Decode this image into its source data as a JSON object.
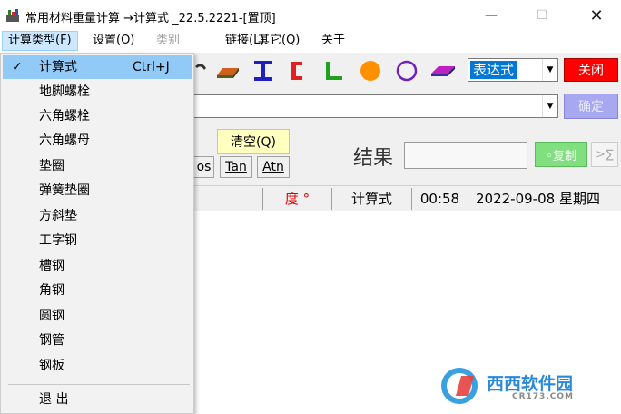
{
  "window": {
    "title": "常用材料重量计算 →计算式 _22.5.2221-[置顶]",
    "minimize_glyph": "—",
    "maximize_glyph": "☐",
    "close_glyph": "✕"
  },
  "menubar": {
    "items": [
      {
        "label": "计算类型(F)",
        "state": "active"
      },
      {
        "label": "设置(O)",
        "state": "normal"
      },
      {
        "label": "类别",
        "state": "disabled"
      },
      {
        "label": "链接(L)",
        "state": "normal"
      },
      {
        "label": "其它(Q)",
        "state": "normal"
      },
      {
        "label": "关于",
        "state": "normal"
      }
    ]
  },
  "toolbar": {
    "icons": [
      "bolt-icon",
      "flat-bar-icon",
      "i-beam-icon",
      "channel-icon",
      "angle-icon",
      "round-bar-icon",
      "pipe-icon",
      "plate-icon"
    ],
    "expression_select": "表达式",
    "close_label": "关闭"
  },
  "input_row": {
    "value": "",
    "confirm_label": "确定"
  },
  "calc_row": {
    "clear_label": "清空(Q)",
    "fn_cos": "os",
    "fn_tan": "Tan",
    "fn_atn": "Atn",
    "result_label": "结果",
    "result_value": "",
    "copy_label": "◦复制",
    "sigma_label": ">∑"
  },
  "statusbar": {
    "unit": "度 °",
    "mode": "计算式",
    "time": "00:58",
    "date": "2022-09-08  星期四"
  },
  "dropdown": {
    "items": [
      {
        "label": "计算式",
        "shortcut": "Ctrl+J",
        "checked": true
      },
      {
        "label": "地脚螺栓"
      },
      {
        "label": "六角螺栓"
      },
      {
        "label": "六角螺母"
      },
      {
        "label": "垫圈"
      },
      {
        "label": "弹簧垫圈"
      },
      {
        "label": "方斜垫"
      },
      {
        "label": "工字钢"
      },
      {
        "label": "槽钢"
      },
      {
        "label": "角钢"
      },
      {
        "label": "圆钢"
      },
      {
        "label": "钢管"
      },
      {
        "label": "钢板"
      }
    ],
    "exit_label": "退  出",
    "check_glyph": "✓"
  },
  "watermark": {
    "main": "西西软件园",
    "sub": "CR173.COM"
  },
  "colors": {
    "menu_active_bg": "#cce8ff",
    "dropdown_selected_bg": "#91c9f7",
    "close_button": "#ff0000",
    "confirm_button": "#a8a8f0",
    "copy_button": "#80e080",
    "clear_button": "#ffffc0",
    "unit_text": "#e00000",
    "select_highlight": "#0078d7"
  }
}
